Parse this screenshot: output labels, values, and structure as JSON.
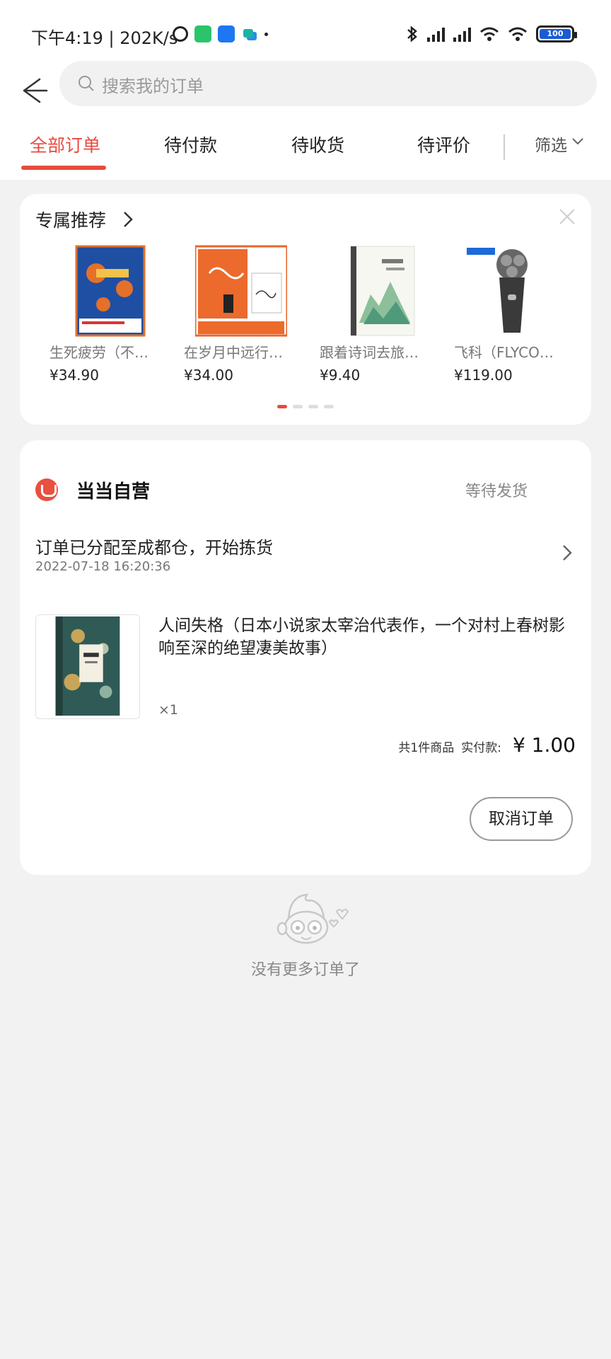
{
  "status_bar": {
    "left_text": "下午4:19 | 202K/s",
    "battery": "100"
  },
  "search": {
    "placeholder": "搜索我的订单"
  },
  "tabs": [
    {
      "label": "全部订单",
      "active": true
    },
    {
      "label": "待付款",
      "active": false
    },
    {
      "label": "待收货",
      "active": false
    },
    {
      "label": "待评价",
      "active": false
    }
  ],
  "filter_label": "筛选",
  "recommend": {
    "title": "专属推荐",
    "products": [
      {
        "name": "生死疲劳（不…",
        "price": "¥34.90"
      },
      {
        "name": "在岁月中远行…",
        "price": "¥34.00"
      },
      {
        "name": "跟着诗词去旅…",
        "price": "¥9.40"
      },
      {
        "name": "飞科（FLYCO…",
        "price": "¥119.00"
      }
    ]
  },
  "order": {
    "store": "当当自营",
    "status": "等待发货",
    "logistics": "订单已分配至成都仓，开始拣货",
    "logistics_time": "2022-07-18 16:20:36",
    "item_title": "人间失格（日本小说家太宰治代表作，一个对村上春树影响至深的绝望凄美故事）",
    "quantity": "×1",
    "count_text": "共1件商品",
    "paid_label": "实付款:",
    "paid_amount": "¥ 1.00",
    "cancel_label": "取消订单"
  },
  "footer_text": "没有更多订单了",
  "colors": {
    "accent": "#e84a3e",
    "background": "#f2f2f2"
  }
}
